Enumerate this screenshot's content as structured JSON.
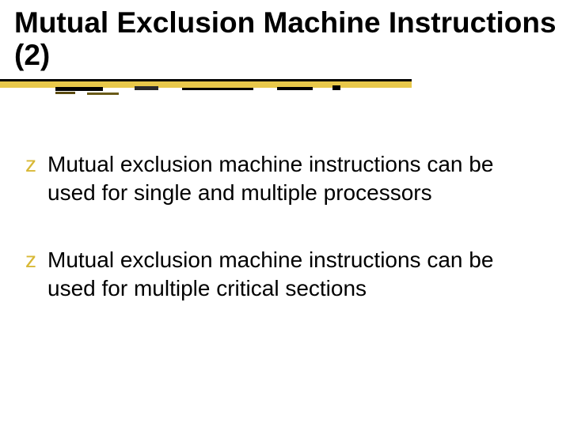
{
  "title": "Mutual Exclusion Machine Instructions (2)",
  "bullets": [
    {
      "marker": "z",
      "text": "Mutual exclusion machine instructions can be used for single and multiple processors"
    },
    {
      "marker": "z",
      "text": "Mutual exclusion machine instructions can be used for multiple critical sections"
    }
  ]
}
